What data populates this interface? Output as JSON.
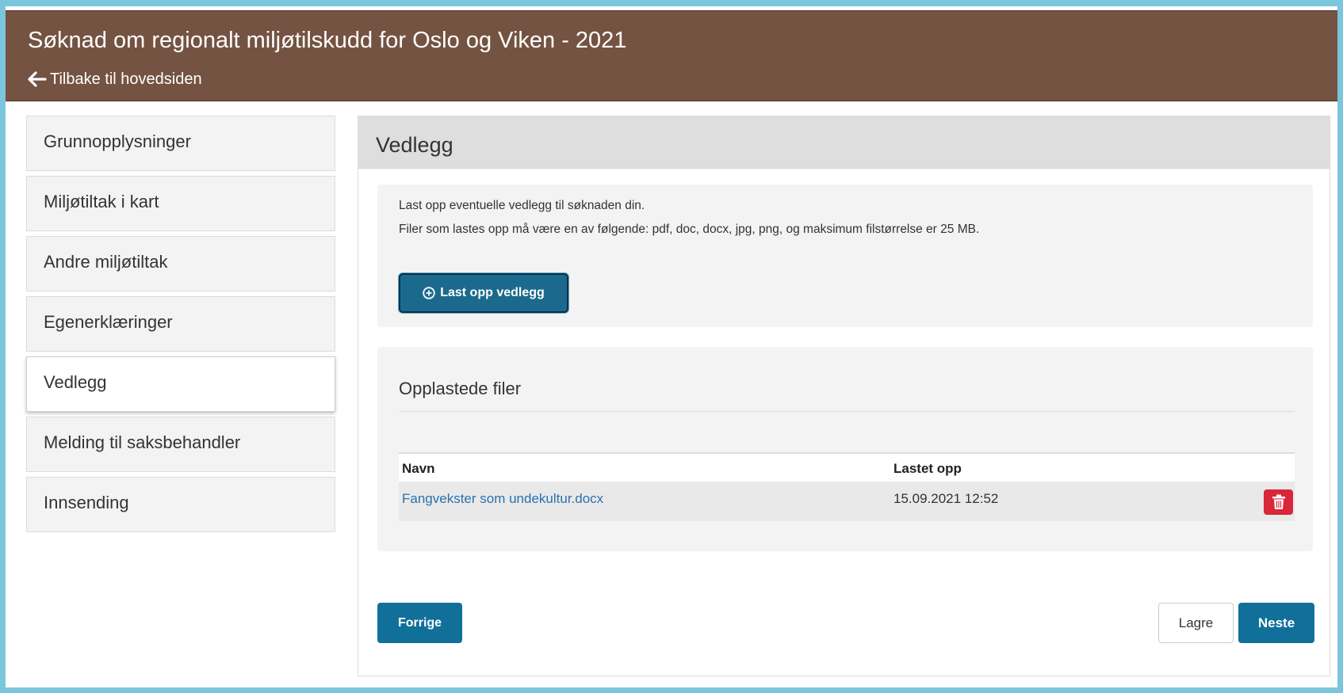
{
  "header": {
    "title": "Søknad om regionalt miljøtilskudd for Oslo og Viken - 2021",
    "back_label": "Tilbake til hovedsiden"
  },
  "sidebar": {
    "items": [
      {
        "label": "Grunnopplysninger",
        "active": false
      },
      {
        "label": "Miljøtiltak i kart",
        "active": false
      },
      {
        "label": "Andre miljøtiltak",
        "active": false
      },
      {
        "label": "Egenerklæringer",
        "active": false
      },
      {
        "label": "Vedlegg",
        "active": true
      },
      {
        "label": "Melding til saksbehandler",
        "active": false
      },
      {
        "label": "Innsending",
        "active": false
      }
    ]
  },
  "main": {
    "title": "Vedlegg",
    "upload_info_1": "Last opp eventuelle vedlegg til søknaden din.",
    "upload_info_2": "Filer som lastes opp må være en av følgende: pdf, doc, docx, jpg, png, og maksimum filstørrelse er 25 MB.",
    "upload_button": "Last opp vedlegg",
    "files_title": "Opplastede filer",
    "table": {
      "columns": [
        "Navn",
        "Lastet opp"
      ],
      "rows": [
        {
          "name": "Fangvekster som undekultur.docx",
          "uploaded": "15.09.2021 12:52"
        }
      ]
    },
    "buttons": {
      "prev": "Forrige",
      "save": "Lagre",
      "next": "Neste"
    }
  },
  "colors": {
    "header_bg": "#745342",
    "primary": "#11709a",
    "danger": "#d9263a",
    "link": "#2a70b0",
    "frame": "#7cc6dd"
  },
  "icons": {
    "back": "arrow-left-icon",
    "upload": "plus-circle-icon",
    "delete": "trash-icon"
  }
}
